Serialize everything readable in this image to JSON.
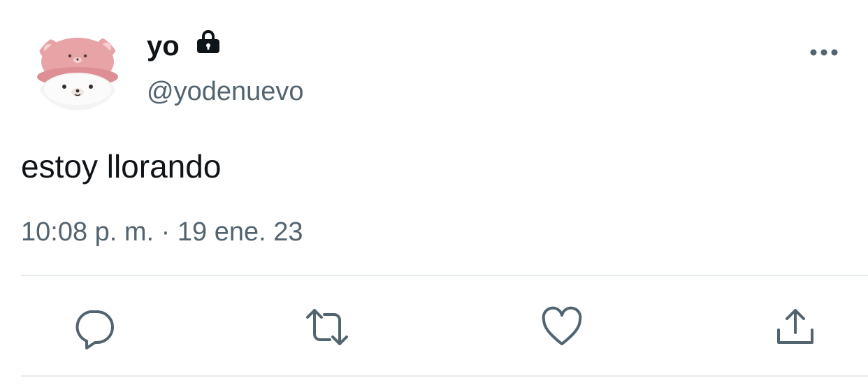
{
  "tweet": {
    "author": {
      "display_name": "yo",
      "handle": "@yodenuevo",
      "protected_icon": "lock-icon",
      "avatar_icon": "bear-hat-avatar"
    },
    "text": "estoy llorando",
    "timestamp": "10:08 p. m. · 19 ene. 23",
    "menu_icon": "more-horizontal-icon",
    "actions": [
      {
        "name": "reply",
        "icon": "reply-bubble-icon"
      },
      {
        "name": "retweet",
        "icon": "retweet-icon"
      },
      {
        "name": "like",
        "icon": "heart-icon"
      },
      {
        "name": "share",
        "icon": "share-icon"
      }
    ]
  },
  "colors": {
    "text_primary": "#0f1419",
    "text_secondary": "#536471",
    "divider": "#e6ebee",
    "avatar_pink": "#e8a3a7"
  }
}
